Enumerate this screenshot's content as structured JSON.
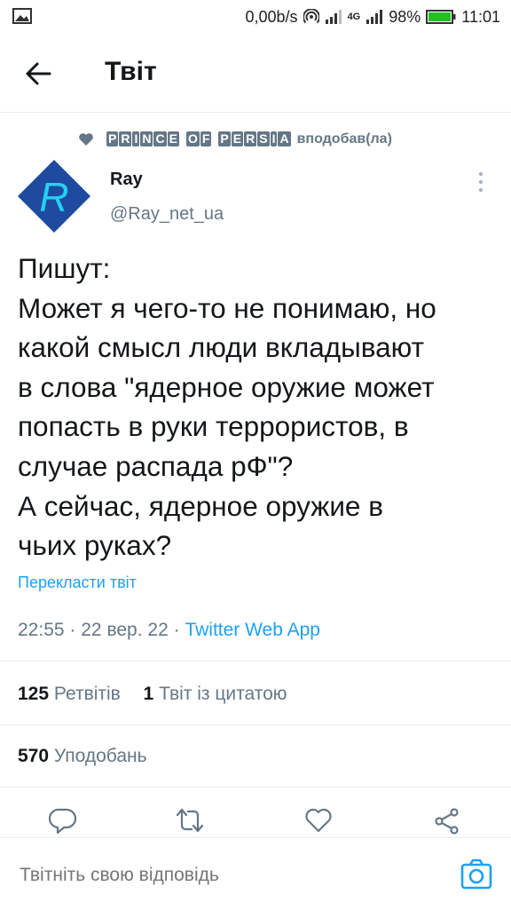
{
  "status_bar": {
    "speed": "0,00b/s",
    "network": "4G",
    "battery": "98%",
    "time": "11:01",
    "battery_color": "#22c022"
  },
  "header": {
    "title": "Твіт"
  },
  "social_context": {
    "liked_by_words": [
      "PRINCE",
      "OF",
      "PERSIA"
    ],
    "liked_by_name": "PRINCE OF PERSIA",
    "action": "вподобав(ла)"
  },
  "author": {
    "avatar_letter": "R",
    "avatar_colors": {
      "background": "#1e4aa0",
      "letter": "#26d0f0"
    },
    "name": "Ray",
    "handle": "@Ray_net_ua"
  },
  "tweet": {
    "lines": [
      "Пишут:",
      "Может я чего-то не понимаю, но",
      "какой смысл люди вкладывают",
      "в слова \"ядерное оружие может",
      "попасть в руки террористов, в",
      "случае распада рФ\"?",
      "А сейчас, ядерное оружие в",
      "чьих руках?"
    ],
    "translate_label": "Перекласти твіт",
    "time": "22:55",
    "date": "22 вер. 22",
    "separator": "·",
    "source": "Twitter Web App"
  },
  "stats": {
    "retweets_count": "125",
    "retweets_label": "Ретвітів",
    "quotes_count": "1",
    "quotes_label": "Твіт із цитатою",
    "likes_count": "570",
    "likes_label": "Уподобань"
  },
  "actions": {
    "icons": [
      "reply-icon",
      "retweet-icon",
      "like-icon",
      "share-icon"
    ],
    "icon_color": "#657786"
  },
  "reply": {
    "placeholder": "Твітніть свою відповідь",
    "accent": "#1da1f2"
  }
}
